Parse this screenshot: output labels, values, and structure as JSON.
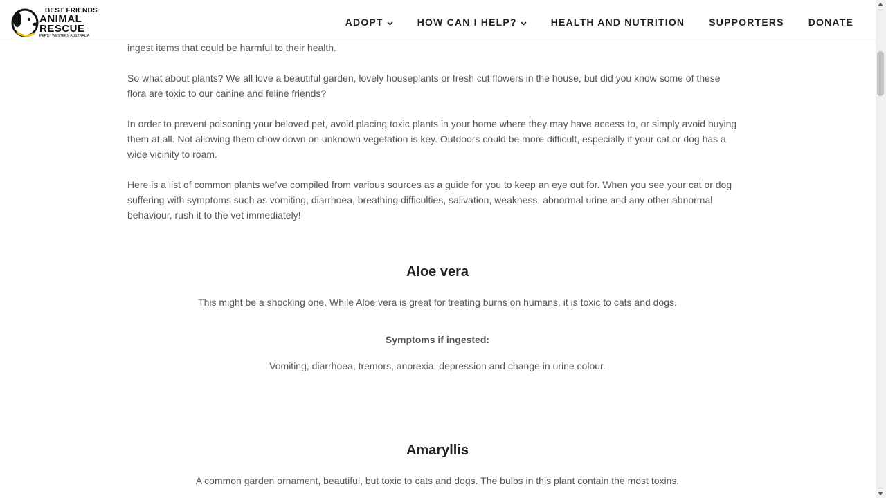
{
  "logo": {
    "line1": "BEST FRIENDS",
    "line2": "ANIMAL",
    "line3": "RESCUE",
    "line4": "PERTH WESTERN AUSTRALIA",
    "accent_color": "#f0c419"
  },
  "nav": {
    "items": [
      {
        "label": "ADOPT",
        "has_dropdown": true
      },
      {
        "label": "HOW CAN I HELP?",
        "has_dropdown": true
      },
      {
        "label": "HEALTH AND NUTRITION",
        "has_dropdown": false
      },
      {
        "label": "SUPPORTERS",
        "has_dropdown": false
      },
      {
        "label": "DONATE",
        "has_dropdown": false
      }
    ]
  },
  "article": {
    "partial_line": "ingest items that could be harmful to their health.",
    "paragraphs": [
      [
        "So what about plants? We all love a beautiful garden, lovely houseplants or fresh cut flowers in the house, but did you know some of these",
        "flora are toxic to our canine and feline friends?"
      ],
      [
        "In order to prevent poisoning your beloved pet, avoid placing toxic plants in your home where they may have access to, or simply avoid buying",
        "them at all. Not allowing them chow down on unknown vegetation is key. Outdoors could be more difficult, especially if your cat or dog has a",
        "wide vicinity to roam."
      ],
      [
        "Here is a list of common plants we’ve compiled from various sources as a guide for you to keep an eye out for. When you see your cat or dog",
        "suffering with symptoms such as vomiting, diarrhoea, breathing difficulties, salivation, weakness, abnormal urine and any other abnormal",
        "behaviour, rush it to the vet immediately!"
      ]
    ]
  },
  "plants": [
    {
      "name": "Aloe vera",
      "description": "This might be a shocking one. While Aloe vera is great for treating burns on humans, it is toxic to cats and dogs.",
      "symptoms_label": "Symptoms if ingested:",
      "symptoms": "Vomiting, diarrhoea, tremors, anorexia, depression and change in urine colour."
    },
    {
      "name": "Amaryllis",
      "description": "A common garden ornament, beautiful, but toxic to cats and dogs. The bulbs in this plant contain the most toxins."
    }
  ]
}
